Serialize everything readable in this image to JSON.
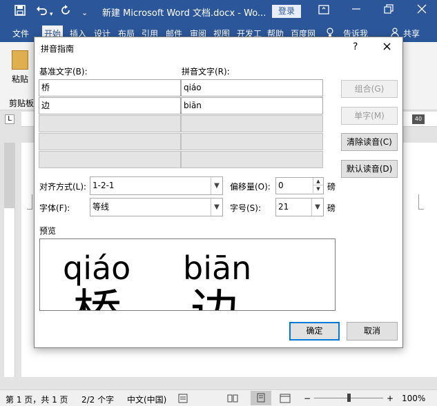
{
  "app": {
    "title": "新建 Microsoft Word 文档.docx  -  Wo...",
    "login": "登录",
    "qat_icons": [
      "save-icon",
      "undo-icon",
      "redo-icon",
      "customize-qat-icon"
    ],
    "window_controls": [
      "ribbon-display-icon",
      "minimize-icon",
      "restore-icon",
      "close-icon"
    ]
  },
  "ribbon": {
    "tabs": [
      "文件",
      "开始",
      "插入",
      "设计",
      "布局",
      "引用",
      "邮件",
      "审阅",
      "视图",
      "开发工",
      "帮助",
      "百度网",
      "告诉我",
      "共享"
    ],
    "active_tab": "开始",
    "paste": "粘贴",
    "clipboard": "剪贴板",
    "ruler_corner": "L",
    "ruler_badge": "40"
  },
  "dialog": {
    "title": "拼音指南",
    "help": "?",
    "close": "×",
    "base_text_label": "基准文字(B):",
    "ruby_text_label": "拼音文字(R):",
    "rows": [
      {
        "base": "桥",
        "ruby": "qiáo"
      },
      {
        "base": "边",
        "ruby": "biān"
      }
    ],
    "empty_rows": 3,
    "buttons": {
      "group": "组合(G)",
      "mono": "单字(M)",
      "clear": "清除读音(C)",
      "default": "默认读音(D)",
      "ok": "确定",
      "cancel": "取消"
    },
    "alignment_label": "对齐方式(L):",
    "alignment_value": "1-2-1",
    "offset_label": "偏移量(O):",
    "offset_value": "0",
    "offset_unit": "磅",
    "font_label": "字体(F):",
    "font_value": "等线",
    "size_label": "字号(S):",
    "size_value": "21",
    "size_unit": "磅",
    "preview_label": "预览",
    "preview": {
      "ruby": [
        "qiáo",
        "biān"
      ],
      "base": [
        "桥",
        "边"
      ]
    }
  },
  "statusbar": {
    "page": "第 1 页，共 1 页",
    "words": "2/2 个字",
    "language": "中文(中国)",
    "zoom": "100%",
    "zoom_minus": "−",
    "zoom_plus": "+"
  }
}
